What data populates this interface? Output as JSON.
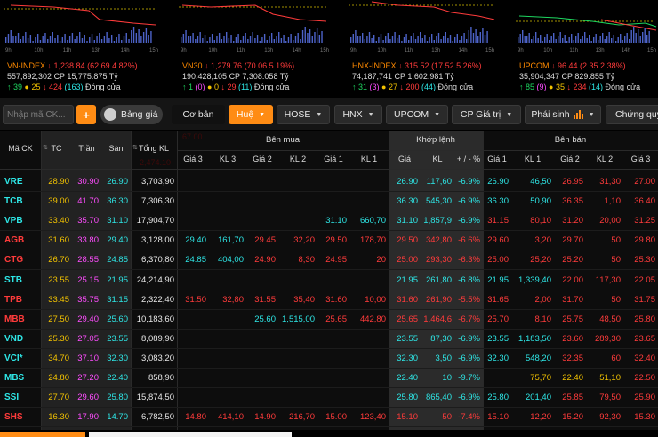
{
  "indices": [
    {
      "name": "VN-INDEX",
      "value": "1,238.84",
      "change": "62.69 4.82%",
      "volume": "557,892,302",
      "cp_label": "CP",
      "cp_value": "15,775.875",
      "unit": "Tỷ",
      "up": "39",
      "ref_count": "25",
      "down": "424",
      "floor": "(163)",
      "status": "Đóng cửa",
      "axis_times": [
        "9h",
        "10h",
        "11h",
        "13h",
        "14h",
        "15h"
      ]
    },
    {
      "name": "VN30",
      "value": "1,279.76",
      "change": "70.06 5.19%",
      "volume": "190,428,105",
      "cp_label": "CP",
      "cp_value": "7,308.058",
      "unit": "Tỷ",
      "up": "1",
      "up_ceil": "(0)",
      "ref_count": "0",
      "down": "29",
      "floor": "(11)",
      "status": "Đóng cửa",
      "axis_times": [
        "9h",
        "10h",
        "11h",
        "13h",
        "14h",
        "15h"
      ]
    },
    {
      "name": "HNX-INDEX",
      "value": "315.52",
      "change": "17.52 5.26%",
      "volume": "74,187,741",
      "cp_label": "CP",
      "cp_value": "1,602.981",
      "unit": "Tỷ",
      "up": "31",
      "up_ceil": "(3)",
      "ref_count": "27",
      "down": "200",
      "floor": "(44)",
      "status": "Đóng cửa",
      "axis_times": [
        "9h",
        "10h",
        "11h",
        "13h",
        "14h",
        "15h"
      ]
    },
    {
      "name": "UPCOM",
      "value": "96.44",
      "change": "2.35 2.38%",
      "volume": "35,904,347",
      "cp_label": "CP",
      "cp_value": "829.855",
      "unit": "Tỷ",
      "up": "85",
      "up_ceil": "(9)",
      "ref_count": "35",
      "down": "234",
      "floor": "(14)",
      "status": "Đóng cửa",
      "axis_times": [
        "9h",
        "10h",
        "11h",
        "13h",
        "14h",
        "15h"
      ]
    }
  ],
  "toolbar": {
    "search_placeholder": "Nhập mã CK...",
    "add_label": "+",
    "toggle_label": "Bảng giá",
    "basic_label": "Cơ bản",
    "tabs": [
      "Huệ",
      "HOSE",
      "HNX",
      "UPCOM",
      "CP Giá trị",
      "Phái sinh",
      "Chứng quy"
    ]
  },
  "board": {
    "headers": {
      "symbol": "Mã CK",
      "ref": "TC",
      "ceiling": "Trần",
      "floor": "Sàn",
      "total_volume": "Tổng KL",
      "bid_group": "Bên mua",
      "match_group": "Khớp lệnh",
      "ask_group": "Bên bán",
      "bid_cols": [
        "Giá 3",
        "KL 3",
        "Giá 2",
        "KL 2",
        "Giá 1",
        "KL 1"
      ],
      "match_cols": [
        "Giá",
        "KL",
        "+ / -",
        "%"
      ],
      "ask_cols": [
        "Giá 1",
        "KL 1",
        "Giá 2",
        "KL 2",
        "Giá 3"
      ]
    },
    "ghost_text": [
      "67.00",
      "2,474.10"
    ],
    "rows": [
      {
        "sym": "VRE",
        "sym_c": "cy",
        "tc": "28.90",
        "tran": "30.90",
        "san": "26.90",
        "tkl": "3,703,90",
        "b3": "",
        "b3c": "",
        "kl3": "",
        "b2": "",
        "b2c": "",
        "kl2": "",
        "b1": "",
        "b1c": "",
        "kl1": "",
        "m": "26.90",
        "mc": "cy",
        "mkl": "117,60",
        "pct": "-6.9%",
        "a1": "26.90",
        "a1c": "cy",
        "akl1": "46,50",
        "a2": "26.95",
        "a2c": "red",
        "akl2": "31,30",
        "a3": "27.00",
        "a3c": "red"
      },
      {
        "sym": "TCB",
        "sym_c": "cy",
        "tc": "39.00",
        "tran": "41.70",
        "san": "36.30",
        "tkl": "7,306,30",
        "b3": "",
        "b3c": "",
        "kl3": "",
        "b2": "",
        "b2c": "",
        "kl2": "",
        "b1": "",
        "b1c": "",
        "kl1": "",
        "m": "36.30",
        "mc": "cy",
        "mkl": "545,30",
        "pct": "-6.9%",
        "a1": "36.30",
        "a1c": "cy",
        "akl1": "50,90",
        "a2": "36.35",
        "a2c": "red",
        "akl2": "1,10",
        "a3": "36.40",
        "a3c": "red"
      },
      {
        "sym": "VPB",
        "sym_c": "cy",
        "tc": "33.40",
        "tran": "35.70",
        "san": "31.10",
        "tkl": "17,904,70",
        "b3": "",
        "b3c": "",
        "kl3": "",
        "b2": "",
        "b2c": "",
        "kl2": "",
        "b1": "31.10",
        "b1c": "cy",
        "kl1": "660,70",
        "m": "31.10",
        "mc": "cy",
        "mkl": "1,857,9",
        "pct": "-6.9%",
        "a1": "31.15",
        "a1c": "red",
        "akl1": "80,10",
        "a2": "31.20",
        "a2c": "red",
        "akl2": "20,00",
        "a3": "31.25",
        "a3c": "red"
      },
      {
        "sym": "AGB",
        "sym_c": "red",
        "tc": "31.60",
        "tran": "33.80",
        "san": "29.40",
        "tkl": "3,128,00",
        "b3": "29.40",
        "b3c": "cy",
        "kl3": "161,70",
        "b2": "29.45",
        "b2c": "red",
        "kl2": "32,20",
        "b1": "29.50",
        "b1c": "red",
        "kl1": "178,70",
        "m": "29.50",
        "mc": "red",
        "mkl": "342,80",
        "pct": "-6.6%",
        "a1": "29.60",
        "a1c": "red",
        "akl1": "3,20",
        "a2": "29.70",
        "a2c": "red",
        "akl2": "50",
        "a3": "29.80",
        "a3c": "red"
      },
      {
        "sym": "CTG",
        "sym_c": "red",
        "tc": "26.70",
        "tran": "28.55",
        "san": "24.85",
        "tkl": "6,370,80",
        "b3": "24.85",
        "b3c": "cy",
        "kl3": "404,00",
        "b2": "24.90",
        "b2c": "red",
        "kl2": "8,30",
        "b1": "24.95",
        "b1c": "red",
        "kl1": "20",
        "m": "25.00",
        "mc": "red",
        "mkl": "293,30",
        "pct": "-6.3%",
        "a1": "25.00",
        "a1c": "red",
        "akl1": "25,20",
        "a2": "25.20",
        "a2c": "red",
        "akl2": "50",
        "a3": "25.30",
        "a3c": "red"
      },
      {
        "sym": "STB",
        "sym_c": "cy",
        "tc": "23.55",
        "tran": "25.15",
        "san": "21.95",
        "tkl": "24,214,90",
        "b3": "",
        "b3c": "",
        "kl3": "",
        "b2": "",
        "b2c": "",
        "kl2": "",
        "b1": "",
        "b1c": "",
        "kl1": "",
        "m": "21.95",
        "mc": "cy",
        "mkl": "261,80",
        "pct": "-6.8%",
        "a1": "21.95",
        "a1c": "cy",
        "akl1": "1,339,40",
        "a2": "22.00",
        "a2c": "red",
        "akl2": "117,30",
        "a3": "22.05",
        "a3c": "red"
      },
      {
        "sym": "TPB",
        "sym_c": "red",
        "tc": "33.45",
        "tran": "35.75",
        "san": "31.15",
        "tkl": "2,322,40",
        "b3": "31.50",
        "b3c": "red",
        "kl3": "32,80",
        "b2": "31.55",
        "b2c": "red",
        "kl2": "35,40",
        "b1": "31.60",
        "b1c": "red",
        "kl1": "10,00",
        "m": "31.60",
        "mc": "red",
        "mkl": "261,90",
        "pct": "-5.5%",
        "a1": "31.65",
        "a1c": "red",
        "akl1": "2,00",
        "a2": "31.70",
        "a2c": "red",
        "akl2": "50",
        "a3": "31.75",
        "a3c": "red"
      },
      {
        "sym": "MBB",
        "sym_c": "red",
        "tc": "27.50",
        "tran": "29.40",
        "san": "25.60",
        "tkl": "10,183,60",
        "b3": "",
        "b3c": "",
        "kl3": "",
        "b2": "25.60",
        "b2c": "cy",
        "kl2": "1,515,00",
        "b1": "25.65",
        "b1c": "red",
        "kl1": "442,80",
        "m": "25.65",
        "mc": "red",
        "mkl": "1,464,6",
        "pct": "-6.7%",
        "a1": "25.70",
        "a1c": "red",
        "akl1": "8,10",
        "a2": "25.75",
        "a2c": "red",
        "akl2": "48,50",
        "a3": "25.80",
        "a3c": "red"
      },
      {
        "sym": "VND",
        "sym_c": "cy",
        "tc": "25.30",
        "tran": "27.05",
        "san": "23.55",
        "tkl": "8,089,90",
        "b3": "",
        "b3c": "",
        "kl3": "",
        "b2": "",
        "b2c": "",
        "kl2": "",
        "b1": "",
        "b1c": "",
        "kl1": "",
        "m": "23.55",
        "mc": "cy",
        "mkl": "87,30",
        "pct": "-6.9%",
        "a1": "23.55",
        "a1c": "cy",
        "akl1": "1,183,50",
        "a2": "23.60",
        "a2c": "red",
        "akl2": "289,30",
        "a3": "23.65",
        "a3c": "red"
      },
      {
        "sym": "VCI*",
        "sym_c": "cy",
        "tc": "34.70",
        "tran": "37.10",
        "san": "32.30",
        "tkl": "3,083,20",
        "b3": "",
        "b3c": "",
        "kl3": "",
        "b2": "",
        "b2c": "",
        "kl2": "",
        "b1": "",
        "b1c": "",
        "kl1": "",
        "m": "32.30",
        "mc": "cy",
        "mkl": "3,50",
        "pct": "-6.9%",
        "a1": "32.30",
        "a1c": "cy",
        "akl1": "548,20",
        "a2": "32.35",
        "a2c": "red",
        "akl2": "60",
        "a3": "32.40",
        "a3c": "red"
      },
      {
        "sym": "MBS",
        "sym_c": "cy",
        "tc": "24.80",
        "tran": "27.20",
        "san": "22.40",
        "tkl": "858,90",
        "b3": "",
        "b3c": "",
        "kl3": "",
        "b2": "",
        "b2c": "",
        "kl2": "",
        "b1": "",
        "b1c": "",
        "kl1": "",
        "m": "22.40",
        "mc": "cy",
        "mkl": "10",
        "pct": "-9.7%",
        "a1": "",
        "a1c": "",
        "akl1": "75,70",
        "a2": "22.40",
        "a2c": "yel",
        "akl2": "51,10",
        "a3": "22.50",
        "a3c": "red"
      },
      {
        "sym": "SSI",
        "sym_c": "cy",
        "tc": "27.70",
        "tran": "29.60",
        "san": "25.80",
        "tkl": "15,874,50",
        "b3": "",
        "b3c": "",
        "kl3": "",
        "b2": "",
        "b2c": "",
        "kl2": "",
        "b1": "",
        "b1c": "",
        "kl1": "",
        "m": "25.80",
        "mc": "cy",
        "mkl": "865,40",
        "pct": "-6.9%",
        "a1": "25.80",
        "a1c": "cy",
        "akl1": "201,40",
        "a2": "25.85",
        "a2c": "red",
        "akl2": "79,50",
        "a3": "25.90",
        "a3c": "red"
      },
      {
        "sym": "SHS",
        "sym_c": "red",
        "tc": "16.30",
        "tran": "17.90",
        "san": "14.70",
        "tkl": "6,782,50",
        "b3": "14.80",
        "b3c": "red",
        "kl3": "414,10",
        "b2": "14.90",
        "b2c": "red",
        "kl2": "216,70",
        "b1": "15.00",
        "b1c": "red",
        "kl1": "123,40",
        "m": "15.10",
        "mc": "red",
        "mkl": "50",
        "pct": "-7.4%",
        "a1": "15.10",
        "a1c": "red",
        "akl1": "12,20",
        "a2": "15.20",
        "a2c": "red",
        "akl2": "92,30",
        "a3": "15.30",
        "a3c": "red"
      }
    ]
  },
  "colors": {
    "up": "#1ed760",
    "down": "#ff3b3b",
    "ceiling": "#ff4dff",
    "floor": "#2ee6e6",
    "reference": "#f2c200",
    "accent": "#ff8c14"
  },
  "icons": [
    "chart-icon"
  ]
}
